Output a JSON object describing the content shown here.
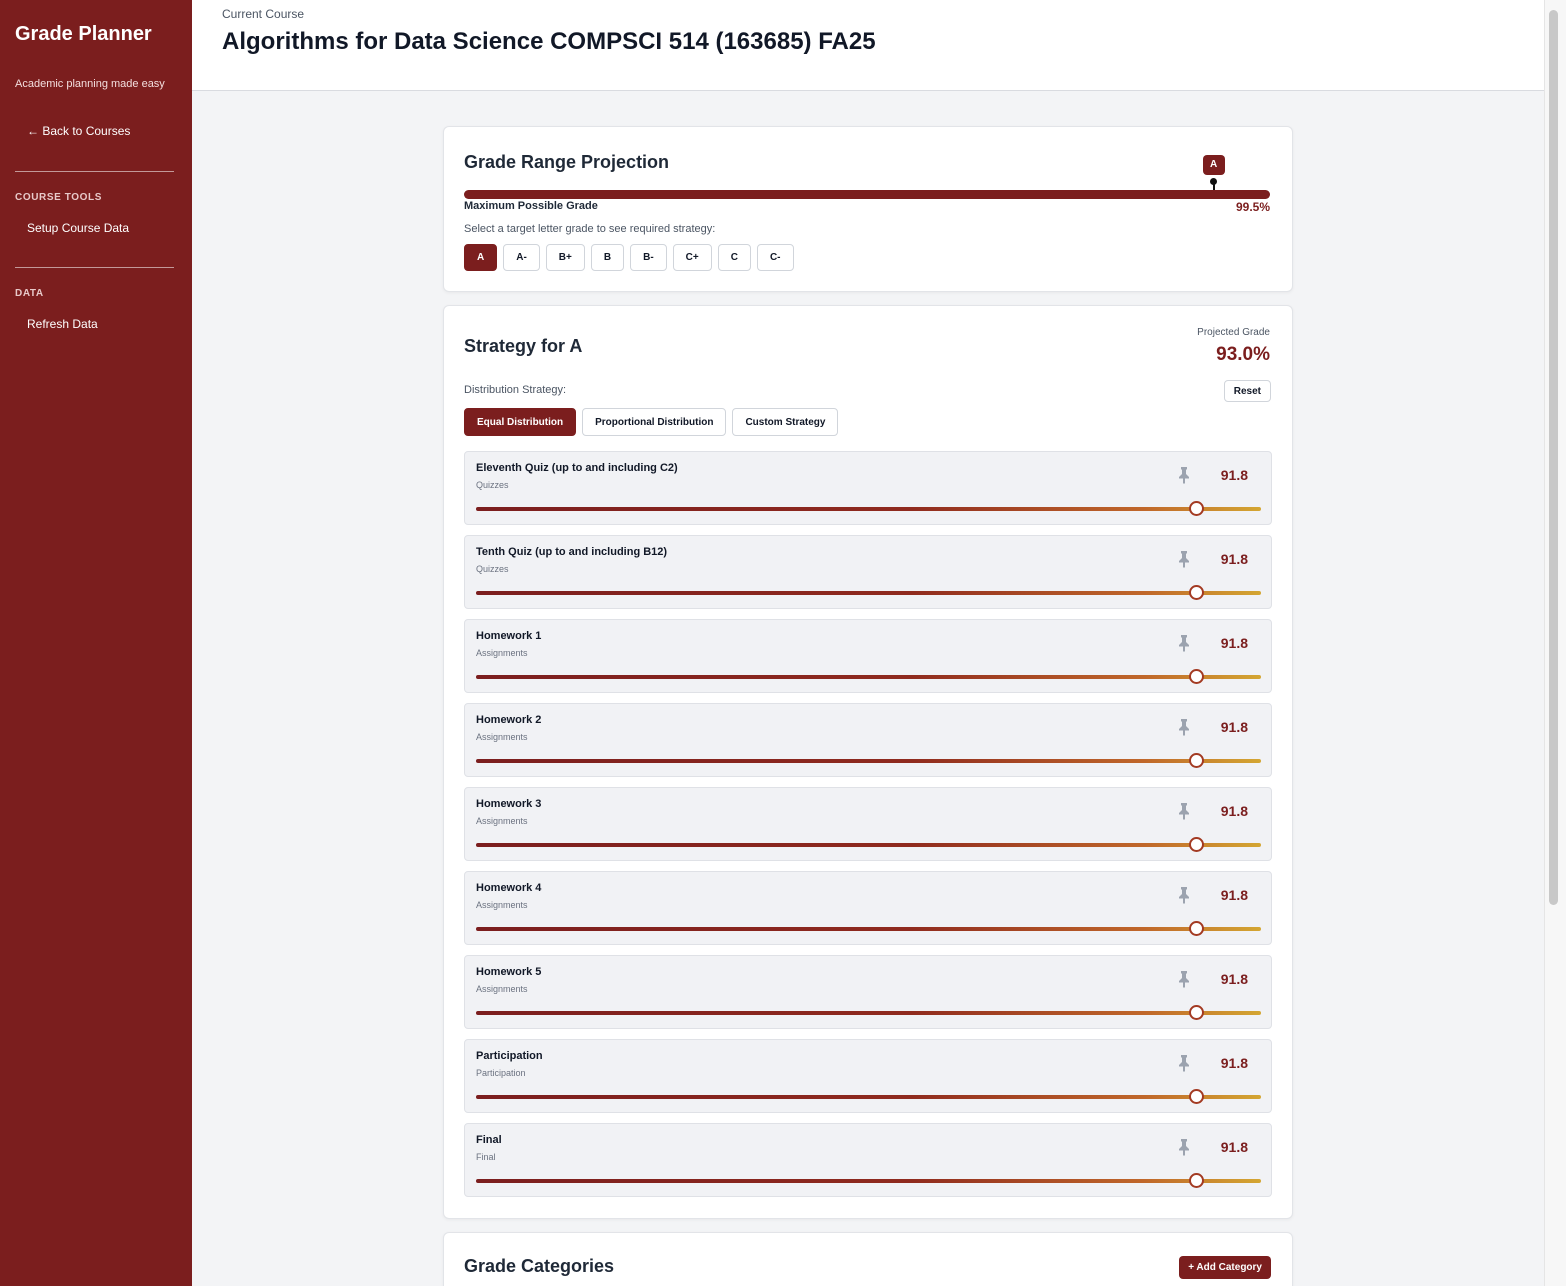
{
  "sidebar": {
    "app_title": "Grade Planner",
    "tagline": "Academic planning made easy",
    "back_link": "← Back to Courses",
    "sections": [
      {
        "label": "COURSE TOOLS",
        "items": [
          "Setup Course Data"
        ]
      },
      {
        "label": "DATA",
        "items": [
          "Refresh Data"
        ]
      }
    ]
  },
  "header": {
    "current_label": "Current Course",
    "course_title": "Algorithms for Data Science COMPSCI 514 (163685) FA25"
  },
  "projection": {
    "title": "Grade Range Projection",
    "marker_label": "A",
    "marker_percent": 93.0,
    "max_label": "Maximum Possible Grade",
    "max_value": "99.5%",
    "instructions": "Select a target letter grade to see required strategy:",
    "grades": [
      "A",
      "A-",
      "B+",
      "B",
      "B-",
      "C+",
      "C",
      "C-"
    ],
    "selected_grade": "A"
  },
  "strategy": {
    "title": "Strategy for A",
    "projected_label": "Projected Grade",
    "projected_value": "93.0%",
    "distribution_label": "Distribution Strategy:",
    "reset_label": "Reset",
    "options": [
      "Equal Distribution",
      "Proportional Distribution",
      "Custom Strategy"
    ],
    "selected_option": "Equal Distribution",
    "items": [
      {
        "name": "Eleventh Quiz (up to and including C2)",
        "category": "Quizzes",
        "value": "91.8",
        "slider_percent": 91.8,
        "pin": "pin-icon"
      },
      {
        "name": "Tenth Quiz (up to and including B12)",
        "category": "Quizzes",
        "value": "91.8",
        "slider_percent": 91.8,
        "pin": "pin-icon"
      },
      {
        "name": "Homework 1",
        "category": "Assignments",
        "value": "91.8",
        "slider_percent": 91.8,
        "pin": "pin-icon"
      },
      {
        "name": "Homework 2",
        "category": "Assignments",
        "value": "91.8",
        "slider_percent": 91.8,
        "pin": "pin-icon"
      },
      {
        "name": "Homework 3",
        "category": "Assignments",
        "value": "91.8",
        "slider_percent": 91.8,
        "pin": "pin-icon"
      },
      {
        "name": "Homework 4",
        "category": "Assignments",
        "value": "91.8",
        "slider_percent": 91.8,
        "pin": "pin-icon"
      },
      {
        "name": "Homework 5",
        "category": "Assignments",
        "value": "91.8",
        "slider_percent": 91.8,
        "pin": "pin-icon"
      },
      {
        "name": "Participation",
        "category": "Participation",
        "value": "91.8",
        "slider_percent": 91.8,
        "pin": "pin-icon"
      },
      {
        "name": "Final",
        "category": "Final",
        "value": "91.8",
        "slider_percent": 91.8,
        "pin": "pin-icon"
      }
    ]
  },
  "categories": {
    "title": "Grade Categories",
    "add_label": "+ Add Category"
  },
  "colors": {
    "brand": "#7b1e1e",
    "slider_start": "#7b1e1e",
    "slider_end": "#d4a632"
  }
}
